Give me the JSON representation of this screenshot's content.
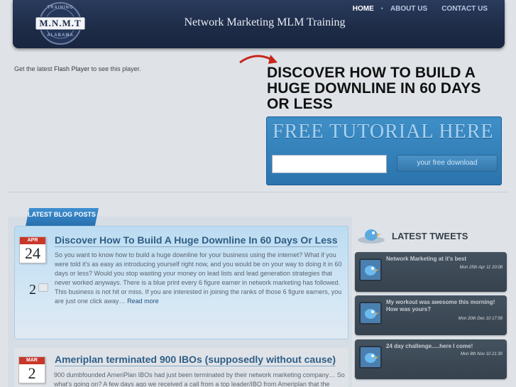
{
  "header": {
    "logo_text": "M.N.M.T",
    "logo_ring_top": "TRAINING",
    "logo_ring_bottom": "ALABAMA",
    "site_title": "Network Marketing MLM Training",
    "nav": [
      {
        "label": "HOME"
      },
      {
        "label": "ABOUT US"
      },
      {
        "label": "CONTACT US"
      }
    ]
  },
  "flash": {
    "prefix": "Get the latest",
    "link": "Flash Player",
    "suffix": "to see this player."
  },
  "hero": {
    "headline": "DISCOVER HOW TO BUILD A HUGE DOWNLINE IN 60 DAYS OR LESS",
    "tutorial_title": "FREE TUTORIAL HERE",
    "input_value": "",
    "button_label": "your free download"
  },
  "blog": {
    "ribbon_label": "LATEST BLOG POSTS",
    "posts": [
      {
        "month": "APR",
        "day": "24",
        "comments": "2",
        "title": "Discover How To Build A Huge Downline In 60 Days Or Less",
        "excerpt": "So you want to know how to build a huge downline for your business using the internet? What if you were told it's as easy as introducing yourself right now, and you would be on your way to doing it in 60 days or less?  Would you stop wasting your money on lead lists and lead generation strategies that never worked anyways. There is a blue print every 6 figure earner in network marketing has followed.  This business is not hit or miss. If you are interested in joining the ranks of those 6 figure earners, you are just one click away…",
        "read_more": "Read more"
      },
      {
        "month": "MAR",
        "day": "2",
        "title": "Ameriplan terminated 900 IBOs (supposedly without cause)",
        "excerpt": "900 dumbfounded AmeriPlan IBOs had just been terminated by their network marketing company… So what's going on? A few days ago we received a call from a top leader/IBO from Ameriplan that the company"
      }
    ]
  },
  "tweets": {
    "heading": "LATEST TWEETS",
    "items": [
      {
        "text": "Network Marketing at it's best",
        "date": "Mon 25th Apr 11 20:08"
      },
      {
        "text": "My workout was awesome this morning! How was yours?",
        "date": "Mon 20th Dec 10 17:58"
      },
      {
        "text": "24 day challenge.....here I come!",
        "date": "Mon 8th Nov 10 21:30"
      }
    ]
  },
  "colors": {
    "accent": "#2f5e86",
    "calendar_red": "#c9372b",
    "header_bg": "#1d2b47"
  }
}
